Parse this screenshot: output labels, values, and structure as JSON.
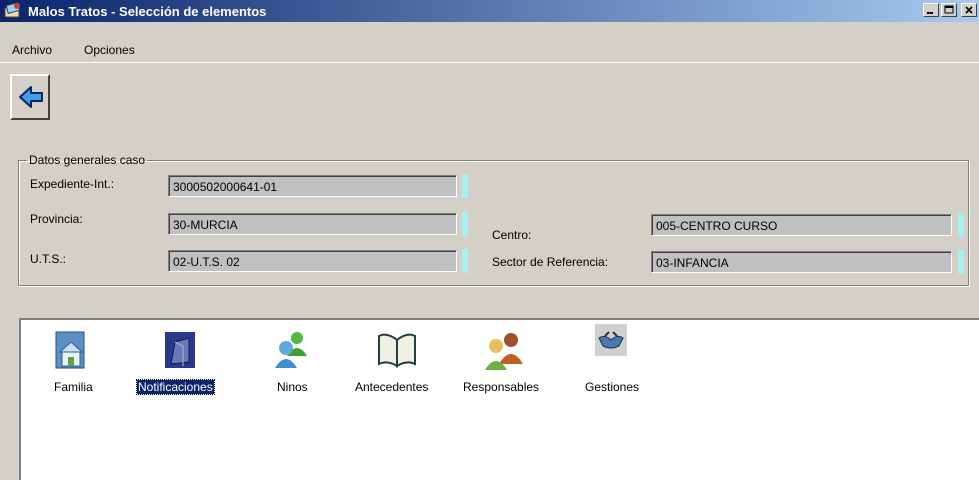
{
  "window": {
    "title": "Malos Tratos - Selección de elementos",
    "controls": {
      "minimize": "_",
      "maximize": "□",
      "close": "x"
    }
  },
  "menu": {
    "items": [
      "Archivo",
      "Opciones"
    ]
  },
  "toolbar": {
    "back_icon": "back-arrow-icon"
  },
  "datos": {
    "legend": "Datos generales caso",
    "expediente_label": "Expediente-Int.:",
    "expediente_value": "3000502000641-01",
    "provincia_label": "Provincia:",
    "provincia_value": "30-MURCIA",
    "uts_label": "U.T.S.:",
    "uts_value": "02-U.T.S. 02",
    "centro_label": "Centro:",
    "centro_value": "005-CENTRO CURSO",
    "sector_label": "Sector de Referencia:",
    "sector_value": "03-INFANCIA"
  },
  "elements": {
    "items": [
      {
        "label": "Familia",
        "icon": "house-icon",
        "selected": false
      },
      {
        "label": "Notificaciones",
        "icon": "notifications-icon",
        "selected": true
      },
      {
        "label": "Ninos",
        "icon": "children-icon",
        "selected": false
      },
      {
        "label": "Antecedentes",
        "icon": "open-book-icon",
        "selected": false
      },
      {
        "label": "Responsables",
        "icon": "people-icon",
        "selected": false
      },
      {
        "label": "Gestiones",
        "icon": "handshake-icon",
        "selected": false
      }
    ]
  },
  "colors": {
    "titlebar_start": "#0a246a",
    "titlebar_end": "#a6caf0",
    "selection": "#0a246a",
    "field_marker": "#a6f0f0"
  }
}
